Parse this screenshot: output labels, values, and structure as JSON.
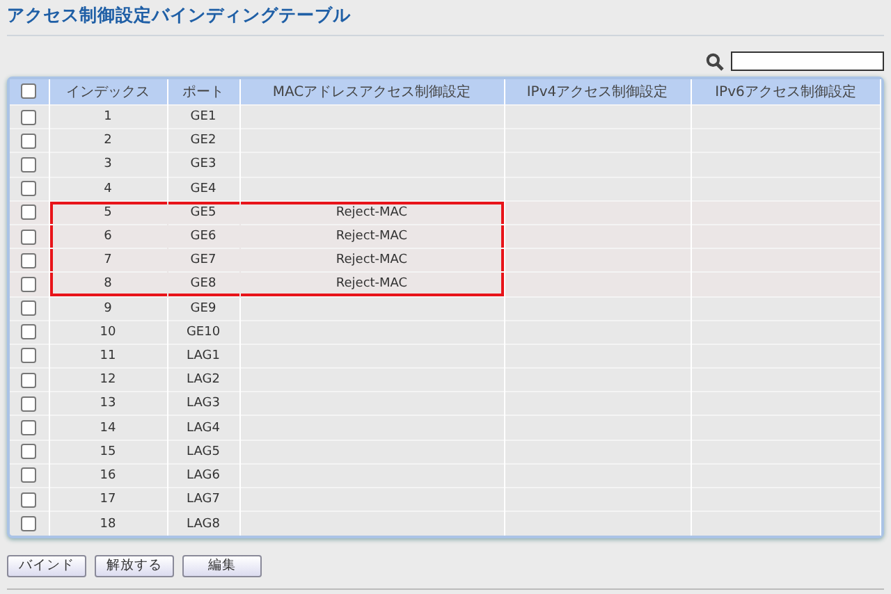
{
  "title": "アクセス制御設定バインディングテーブル",
  "table": {
    "columns": [
      "インデックス",
      "ポート",
      "MACアドレスアクセス制御設定",
      "IPv4アクセス制御設定",
      "IPv6アクセス制御設定"
    ],
    "header_checked": false,
    "rows": [
      {
        "index": "1",
        "port": "GE1",
        "mac": "",
        "checked": false,
        "highlighted": false
      },
      {
        "index": "2",
        "port": "GE2",
        "mac": "",
        "checked": false,
        "highlighted": false
      },
      {
        "index": "3",
        "port": "GE3",
        "mac": "",
        "checked": false,
        "highlighted": false
      },
      {
        "index": "4",
        "port": "GE4",
        "mac": "",
        "checked": false,
        "highlighted": false
      },
      {
        "index": "5",
        "port": "GE5",
        "mac": "Reject-MAC",
        "checked": false,
        "highlighted": true
      },
      {
        "index": "6",
        "port": "GE6",
        "mac": "Reject-MAC",
        "checked": false,
        "highlighted": true
      },
      {
        "index": "7",
        "port": "GE7",
        "mac": "Reject-MAC",
        "checked": false,
        "highlighted": true
      },
      {
        "index": "8",
        "port": "GE8",
        "mac": "Reject-MAC",
        "checked": false,
        "highlighted": true
      },
      {
        "index": "9",
        "port": "GE9",
        "mac": "",
        "checked": false,
        "highlighted": false
      },
      {
        "index": "10",
        "port": "GE10",
        "mac": "",
        "checked": false,
        "highlighted": false
      },
      {
        "index": "11",
        "port": "LAG1",
        "mac": "",
        "checked": false,
        "highlighted": false
      },
      {
        "index": "12",
        "port": "LAG2",
        "mac": "",
        "checked": false,
        "highlighted": false
      },
      {
        "index": "13",
        "port": "LAG3",
        "mac": "",
        "checked": false,
        "highlighted": false
      },
      {
        "index": "14",
        "port": "LAG4",
        "mac": "",
        "checked": false,
        "highlighted": false
      },
      {
        "index": "15",
        "port": "LAG5",
        "mac": "",
        "checked": false,
        "highlighted": false
      },
      {
        "index": "16",
        "port": "LAG6",
        "mac": "",
        "checked": false,
        "highlighted": false
      },
      {
        "index": "17",
        "port": "LAG7",
        "mac": "",
        "checked": false,
        "highlighted": false
      },
      {
        "index": "18",
        "port": "LAG8",
        "mac": "",
        "checked": false,
        "highlighted": false
      }
    ]
  },
  "buttons": [
    "バインド",
    "解放する",
    "編集"
  ]
}
